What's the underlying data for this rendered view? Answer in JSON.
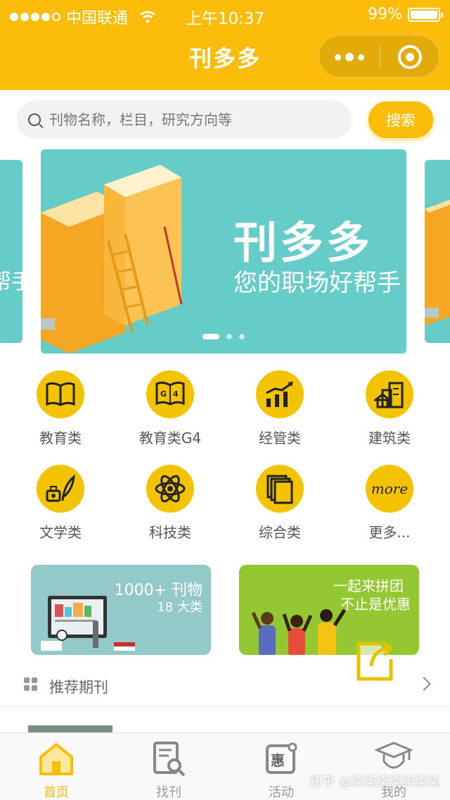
{
  "status_bar": {
    "carrier": "中国联通",
    "time": "上午10:37",
    "battery": "99%",
    "battery_level": 0.99
  },
  "nav": {
    "title": "刊多多"
  },
  "search": {
    "placeholder": "刊物名称，栏目，研究方向等",
    "button_label": "搜索"
  },
  "banner": {
    "title": "刊多多",
    "subtitle": "您的职场好帮手",
    "left_peek": "帮手",
    "slide_count": 3,
    "active_index": 0
  },
  "categories": [
    {
      "label": "教育类",
      "icon": "book-icon"
    },
    {
      "label": "教育类G4",
      "icon": "g4-book-icon"
    },
    {
      "label": "经管类",
      "icon": "chart-icon"
    },
    {
      "label": "建筑类",
      "icon": "buildings-icon"
    },
    {
      "label": "文学类",
      "icon": "ink-quill-icon"
    },
    {
      "label": "科技类",
      "icon": "atom-icon"
    },
    {
      "label": "综合类",
      "icon": "stack-icon"
    },
    {
      "label": "更多...",
      "icon": "more-icon",
      "icon_text": "more"
    }
  ],
  "promos": [
    {
      "line1": "1000+ 刊物",
      "line2": "18 大类"
    },
    {
      "line1": "一起来拼团",
      "line2": "不止是优惠"
    }
  ],
  "recommended": {
    "title": "推荐期刊"
  },
  "tabs": [
    {
      "label": "首页",
      "icon": "home-icon",
      "active": true
    },
    {
      "label": "找刊",
      "icon": "search-doc-icon",
      "active": false
    },
    {
      "label": "活动",
      "icon": "hui-icon",
      "icon_text": "惠",
      "active": false
    },
    {
      "label": "我的",
      "icon": "graduate-icon",
      "active": false
    }
  ],
  "watermark": "知乎 @柒柒柒柒柒柒柒",
  "colors": {
    "brand_yellow": "#fbbd09",
    "icon_yellow": "#f3c300",
    "banner_teal": "#66ccc8",
    "promo_teal": "#94c9ca",
    "promo_green": "#94c832"
  }
}
